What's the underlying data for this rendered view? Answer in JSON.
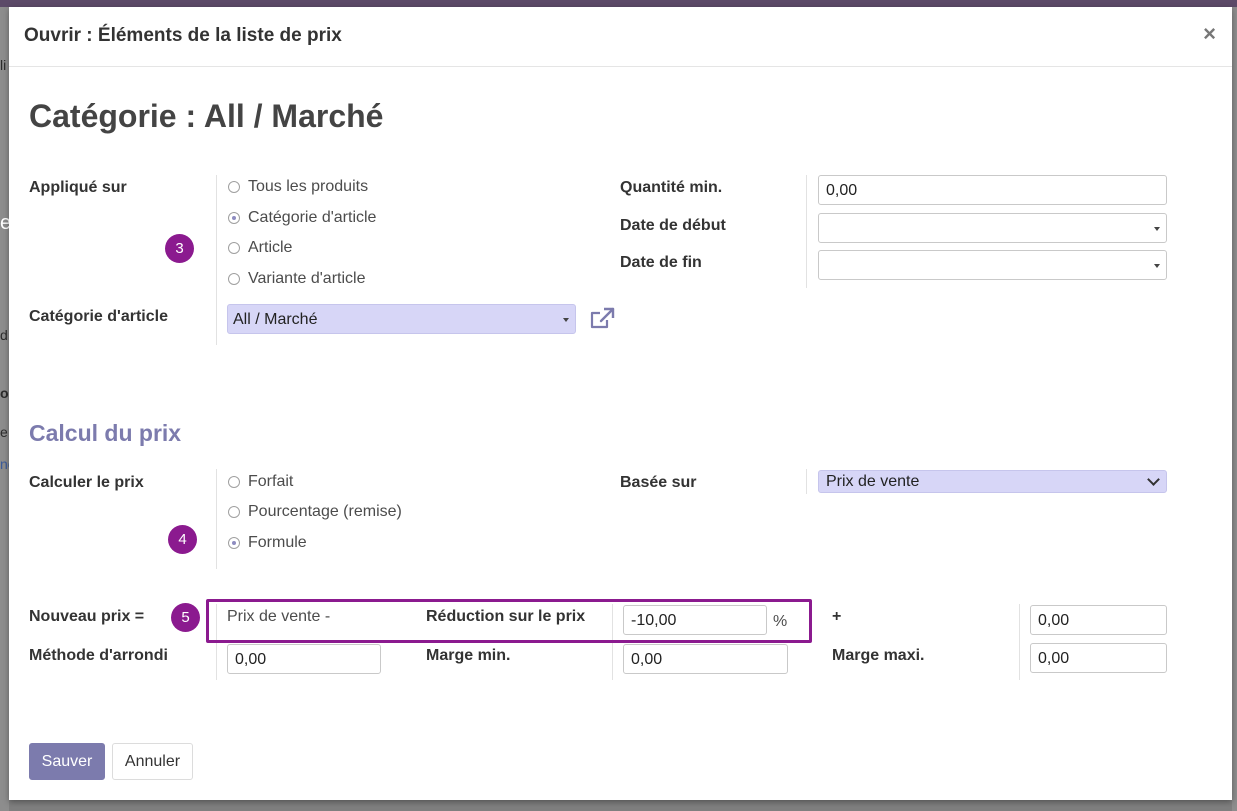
{
  "background": {
    "topbar_color": "#5c4a68",
    "side_fragments": [
      "li",
      "e",
      "d",
      "o",
      "e",
      "ne"
    ]
  },
  "dialog": {
    "title": "Ouvrir : Éléments de la liste de prix",
    "close_label": "×"
  },
  "record_title": "Catégorie : All / Marché",
  "applied_on": {
    "label": "Appliqué sur",
    "options": [
      {
        "label": "Tous les produits",
        "checked": false
      },
      {
        "label": "Catégorie d'article",
        "checked": true
      },
      {
        "label": "Article",
        "checked": false
      },
      {
        "label": "Variante d'article",
        "checked": false
      }
    ]
  },
  "quantity_min": {
    "label": "Quantité min.",
    "value": "0,00"
  },
  "date_start": {
    "label": "Date de début",
    "value": ""
  },
  "date_end": {
    "label": "Date de fin",
    "value": ""
  },
  "category": {
    "label": "Catégorie d'article",
    "value": "All / Marché",
    "external_link_icon": "external-link-icon"
  },
  "price_section": {
    "title": "Calcul du prix"
  },
  "compute_price": {
    "label": "Calculer le prix",
    "options": [
      {
        "label": "Forfait",
        "checked": false
      },
      {
        "label": "Pourcentage (remise)",
        "checked": false
      },
      {
        "label": "Formule",
        "checked": true
      }
    ]
  },
  "based_on": {
    "label": "Basée sur",
    "value": "Prix de vente"
  },
  "formula": {
    "new_price_label": "Nouveau prix =",
    "base_text": "Prix de vente -",
    "discount_label": "Réduction sur le prix",
    "discount_value": "-10,00",
    "percent_sign": "%",
    "plus_label": "+",
    "surcharge_value": "0,00",
    "rounding_label": "Méthode d'arrondi",
    "rounding_value": "0,00",
    "min_margin_label": "Marge min.",
    "min_margin_value": "0,00",
    "max_margin_label": "Marge maxi.",
    "max_margin_value": "0,00"
  },
  "badges": [
    "3",
    "4",
    "5"
  ],
  "colors": {
    "accent": "#7c7bad",
    "badge": "#8b1a8f",
    "select_bg": "#d7d6f7"
  },
  "footer": {
    "save_label": "Sauver",
    "cancel_label": "Annuler"
  }
}
